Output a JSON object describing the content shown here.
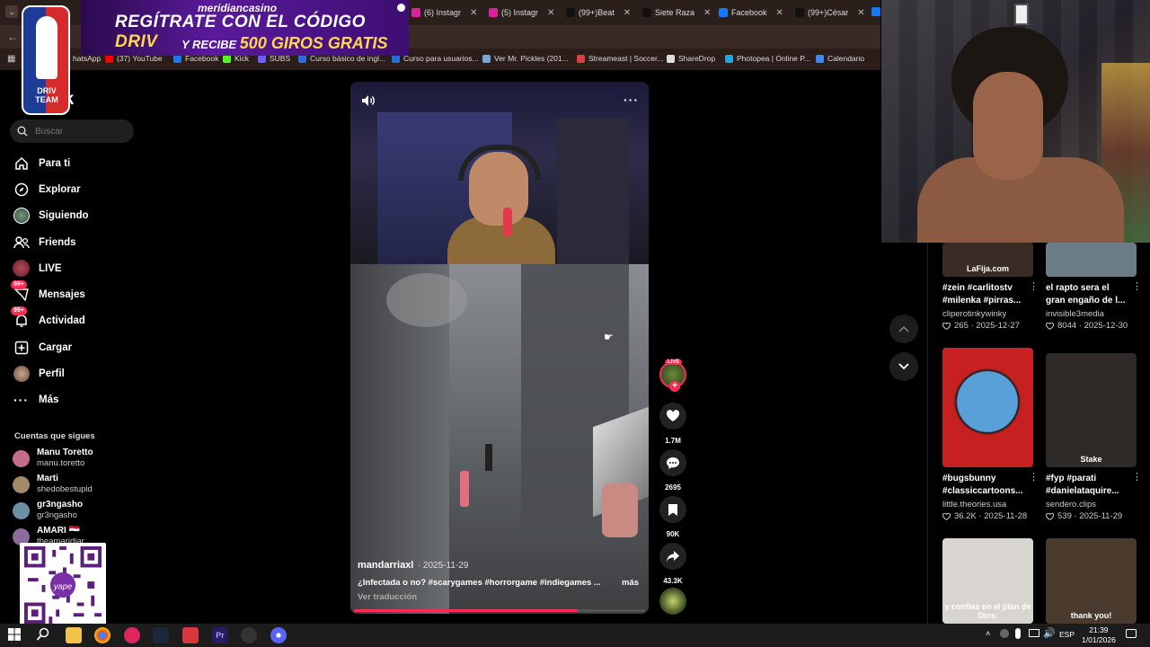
{
  "tabs": [
    {
      "label": "(6) Instagr",
      "color": "#d6249f"
    },
    {
      "label": "(5) Instagr",
      "color": "#d6249f"
    },
    {
      "label": "(99+)Beat",
      "color": "#111111"
    },
    {
      "label": "Siete Raza",
      "color": "#111111"
    },
    {
      "label": "Facebook",
      "color": "#1877f2"
    },
    {
      "label": "(99+)César",
      "color": "#111111"
    }
  ],
  "bookmarks": [
    {
      "label": "hatsApp",
      "color": "#25d366"
    },
    {
      "label": "(37) YouTube",
      "color": "#ff0000"
    },
    {
      "label": "Facebook",
      "color": "#1877f2"
    },
    {
      "label": "Kick",
      "color": "#53fc18"
    },
    {
      "label": "SUBS",
      "color": "#6b5cff"
    },
    {
      "label": "Curso básico de ingl...",
      "color": "#2d6cdf"
    },
    {
      "label": "Curso para usuarios...",
      "color": "#2d6cdf"
    },
    {
      "label": "Ver Mr. Pickles (201...",
      "color": "#7aa5d8"
    },
    {
      "label": "Streameast | Soccer...",
      "color": "#e23b3b"
    },
    {
      "label": "ShareDrop",
      "color": "#dddddd"
    },
    {
      "label": "Photopea | Online P...",
      "color": "#1ba8e0"
    },
    {
      "label": "Calendario",
      "color": "#4285f4"
    }
  ],
  "ad": {
    "brand": "meridiancasino",
    "line1": "REGÍTRATE CON EL CÓDIGO",
    "code": "DRIV",
    "line2": "Y RECIBE",
    "offer": "500 GIROS GRATIS"
  },
  "logo": {
    "text": "DRIV TEAM"
  },
  "brand_partial": "ok",
  "search": {
    "placeholder": "Buscar"
  },
  "nav": [
    {
      "label": "Para ti",
      "icon": "home-icon"
    },
    {
      "label": "Explorar",
      "icon": "compass-icon"
    },
    {
      "label": "Siguiendo",
      "icon": "following-avatar-icon"
    },
    {
      "label": "Friends",
      "icon": "friends-icon"
    },
    {
      "label": "LIVE",
      "icon": "live-icon"
    },
    {
      "label": "Mensajes",
      "icon": "messages-icon",
      "badge": "99+"
    },
    {
      "label": "Actividad",
      "icon": "activity-icon",
      "badge": "99+"
    },
    {
      "label": "Cargar",
      "icon": "upload-icon"
    },
    {
      "label": "Perfil",
      "icon": "profile-icon"
    },
    {
      "label": "Más",
      "icon": "more-icon"
    }
  ],
  "following_title": "Cuentas que sigues",
  "following": [
    {
      "name": "Manu Toretto",
      "handle": "manu.toretto",
      "color": "#c46a8a"
    },
    {
      "name": "Marti",
      "handle": "shedobestupid",
      "color": "#a4896b"
    },
    {
      "name": "gr3ngasho",
      "handle": "gr3ngasho",
      "color": "#6b8fa4"
    },
    {
      "name": "AMARI 🇾🇪",
      "handle": "theamaridiar",
      "color": "#8a6b9a"
    }
  ],
  "video": {
    "author": "mandarriaxl",
    "date": "· 2025-11-29",
    "caption": "¿Infectada o no? #scarygames #horrorgame #indiegames ...",
    "more": "más",
    "translate": "Ver traducción",
    "progress": 0.77
  },
  "actions": {
    "live_badge": "LIVE",
    "likes": "1.7M",
    "comments": "2695",
    "saves": "90K",
    "shares": "43.3K"
  },
  "grid": [
    {
      "title": "#zein #carlitostv #milenka #pirras...",
      "user": "cliperotinkywinky",
      "stats": "265 · 2025-12-27",
      "thumb": "#3a2b24",
      "thumb_text": "LaFija.com"
    },
    {
      "title": "el rapto sera el gran engaño de l...",
      "user": "invisible3media",
      "stats": "8044 · 2025-12-30",
      "thumb": "#6c7c86",
      "thumb_text": ""
    },
    {
      "title": "#bugsbunny #classiccartoons...",
      "user": "little.theories.usa",
      "stats": "36.2K · 2025-11-28",
      "thumb": "#c62020",
      "thumb_text": ""
    },
    {
      "title": "#fyp #parati #danielataquire...",
      "user": "sendero.clips",
      "stats": "539 · 2025-11-29",
      "thumb": "#2e2a28",
      "thumb_text": "Stake"
    },
    {
      "title": "",
      "user": "",
      "stats": "",
      "thumb": "#d8d4d0",
      "thumb_text": "y confías en el plan de Dios."
    },
    {
      "title": "",
      "user": "",
      "stats": "",
      "thumb": "#4a3a2e",
      "thumb_text": "thank you!"
    }
  ],
  "taskbar": {
    "lang": "ESP",
    "time": "21:39",
    "date": "1/01/2026"
  }
}
